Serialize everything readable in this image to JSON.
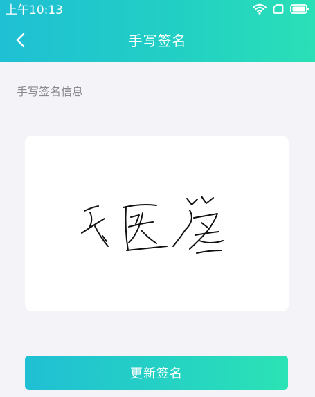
{
  "status_bar": {
    "time": "上午10:13",
    "icons": [
      "wifi-icon",
      "sim-card-icon",
      "battery-icon"
    ]
  },
  "nav": {
    "back_icon": "chevron-left-icon",
    "title": "手写签名"
  },
  "section": {
    "label": "手写签名信息"
  },
  "signature": {
    "handwritten_text": "云医签"
  },
  "actions": {
    "update_label": "更新签名"
  },
  "colors": {
    "accent_start": "#1fc0d4",
    "accent_end": "#2ae0b6",
    "background": "#f4f4f8",
    "card": "#ffffff",
    "label": "#8a8a8f"
  }
}
